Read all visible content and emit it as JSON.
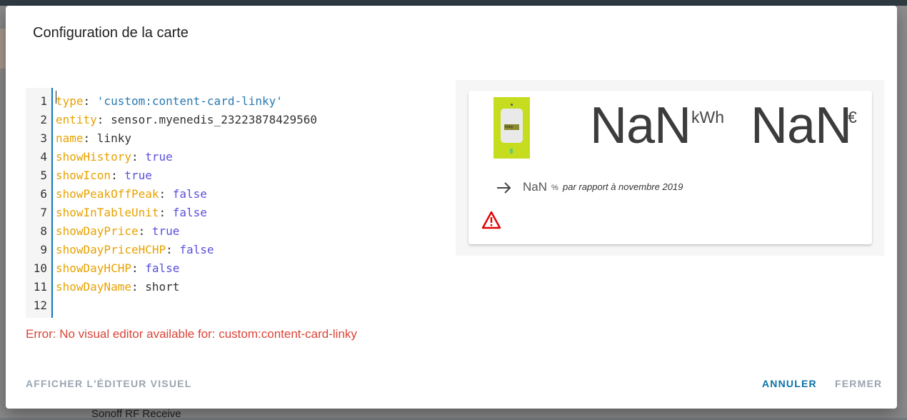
{
  "dialog": {
    "title": "Configuration de la carte"
  },
  "editor": {
    "lines": [
      {
        "n": "1",
        "key": "type",
        "sep": ": ",
        "val": "'custom:content-card-linky'",
        "kind": "string"
      },
      {
        "n": "2",
        "key": "entity",
        "sep": ": ",
        "val": "sensor.myenedis_23223878429560",
        "kind": "plain"
      },
      {
        "n": "3",
        "key": "name",
        "sep": ": ",
        "val": "linky",
        "kind": "plain"
      },
      {
        "n": "4",
        "key": "showHistory",
        "sep": ": ",
        "val": "true",
        "kind": "bool"
      },
      {
        "n": "5",
        "key": "showIcon",
        "sep": ": ",
        "val": "true",
        "kind": "bool"
      },
      {
        "n": "6",
        "key": "showPeakOffPeak",
        "sep": ": ",
        "val": "false",
        "kind": "bool"
      },
      {
        "n": "7",
        "key": "showInTableUnit",
        "sep": ": ",
        "val": "false",
        "kind": "bool"
      },
      {
        "n": "8",
        "key": "showDayPrice",
        "sep": ": ",
        "val": "true",
        "kind": "bool"
      },
      {
        "n": "9",
        "key": "showDayPriceHCHP",
        "sep": ": ",
        "val": "false",
        "kind": "bool"
      },
      {
        "n": "10",
        "key": "showDayHCHP",
        "sep": ": ",
        "val": "false",
        "kind": "bool"
      },
      {
        "n": "11",
        "key": "showDayName",
        "sep": ": ",
        "val": "short",
        "kind": "plain"
      },
      {
        "n": "12",
        "key": "",
        "sep": "",
        "val": "",
        "kind": "plain"
      }
    ],
    "error": "Error: No visual editor available for: custom:content-card-linky"
  },
  "preview": {
    "linky_label": "linky",
    "kwh_value": "NaN",
    "kwh_unit": "kWh",
    "eur_value": "NaN",
    "eur_unit": "€",
    "trend_value": "NaN",
    "trend_unit": "%",
    "trend_compare": "par rapport à novembre 2019",
    "icons": {
      "trend": "arrow-right-icon",
      "warning": "warning-triangle-icon"
    }
  },
  "buttons": {
    "visual_editor": "AFFICHER L'ÉDITEUR VISUEL",
    "cancel": "ANNULER",
    "close": "FERMER"
  },
  "background": {
    "fragment": "Sonoff RF Receive"
  },
  "colors": {
    "key": "#e8a200",
    "string": "#2a7ab0",
    "bool": "#5a4fdc",
    "error": "#db4437",
    "primary": "#0b72a7",
    "linky_green": "#c6dc1e"
  }
}
